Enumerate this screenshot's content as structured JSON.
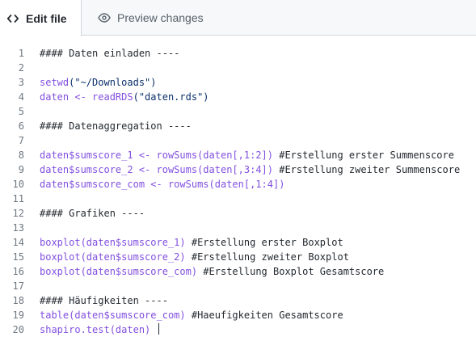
{
  "tabs": {
    "edit_label": "Edit file",
    "preview_label": "Preview changes"
  },
  "icons": {
    "edit": "code-brackets-icon",
    "preview": "eye-icon"
  },
  "lines": [
    {
      "n": "1",
      "tokens": [
        {
          "t": "#### Daten einladen ----",
          "c": "cm"
        }
      ]
    },
    {
      "n": "2",
      "tokens": []
    },
    {
      "n": "3",
      "tokens": [
        {
          "t": "setwd",
          "c": "fn"
        },
        {
          "t": "(\"~/Downloads\")",
          "c": "str"
        }
      ]
    },
    {
      "n": "4",
      "tokens": [
        {
          "t": "daten <- ",
          "c": "fn"
        },
        {
          "t": "readRDS",
          "c": "fn"
        },
        {
          "t": "(\"daten.rds\")",
          "c": "str"
        }
      ]
    },
    {
      "n": "5",
      "tokens": []
    },
    {
      "n": "6",
      "tokens": [
        {
          "t": "#### Datenaggregation ----",
          "c": "cm"
        }
      ]
    },
    {
      "n": "7",
      "tokens": []
    },
    {
      "n": "8",
      "tokens": [
        {
          "t": "daten$sumscore_1 <- ",
          "c": "fn"
        },
        {
          "t": "rowSums",
          "c": "fn"
        },
        {
          "t": "(daten[,1:2]) ",
          "c": "fn"
        },
        {
          "t": "#Erstellung erster Summenscore",
          "c": "cm"
        }
      ]
    },
    {
      "n": "9",
      "tokens": [
        {
          "t": "daten$sumscore_2 <- ",
          "c": "fn"
        },
        {
          "t": "rowSums",
          "c": "fn"
        },
        {
          "t": "(daten[,3:4]) ",
          "c": "fn"
        },
        {
          "t": "#Erstellung zweiter Summenscore",
          "c": "cm"
        }
      ]
    },
    {
      "n": "10",
      "tokens": [
        {
          "t": "daten$sumscore_com <- ",
          "c": "fn"
        },
        {
          "t": "rowSums",
          "c": "fn"
        },
        {
          "t": "(daten[,1:4])",
          "c": "fn"
        }
      ]
    },
    {
      "n": "11",
      "tokens": []
    },
    {
      "n": "12",
      "tokens": [
        {
          "t": "#### Grafiken ----",
          "c": "cm"
        }
      ]
    },
    {
      "n": "13",
      "tokens": []
    },
    {
      "n": "14",
      "tokens": [
        {
          "t": "boxplot",
          "c": "fn"
        },
        {
          "t": "(daten$sumscore_1) ",
          "c": "fn"
        },
        {
          "t": "#Erstellung erster Boxplot",
          "c": "cm"
        }
      ]
    },
    {
      "n": "15",
      "tokens": [
        {
          "t": "boxplot",
          "c": "fn"
        },
        {
          "t": "(daten$sumscore_2) ",
          "c": "fn"
        },
        {
          "t": "#Erstellung zweiter Boxplot",
          "c": "cm"
        }
      ]
    },
    {
      "n": "16",
      "tokens": [
        {
          "t": "boxplot",
          "c": "fn"
        },
        {
          "t": "(daten$sumscore_com) ",
          "c": "fn"
        },
        {
          "t": "#Erstellung Boxplot Gesamtscore",
          "c": "cm"
        }
      ]
    },
    {
      "n": "17",
      "tokens": []
    },
    {
      "n": "18",
      "tokens": [
        {
          "t": "#### Häufigkeiten ----",
          "c": "cm"
        }
      ]
    },
    {
      "n": "19",
      "tokens": [
        {
          "t": "table",
          "c": "fn"
        },
        {
          "t": "(daten$sumscore_com) ",
          "c": "fn"
        },
        {
          "t": "#Haeufigkeiten Gesamtscore",
          "c": "cm"
        }
      ]
    },
    {
      "n": "20",
      "tokens": [
        {
          "t": "shapiro.test",
          "c": "fn"
        },
        {
          "t": "(daten) ",
          "c": "fn"
        }
      ],
      "cursor": true
    }
  ]
}
